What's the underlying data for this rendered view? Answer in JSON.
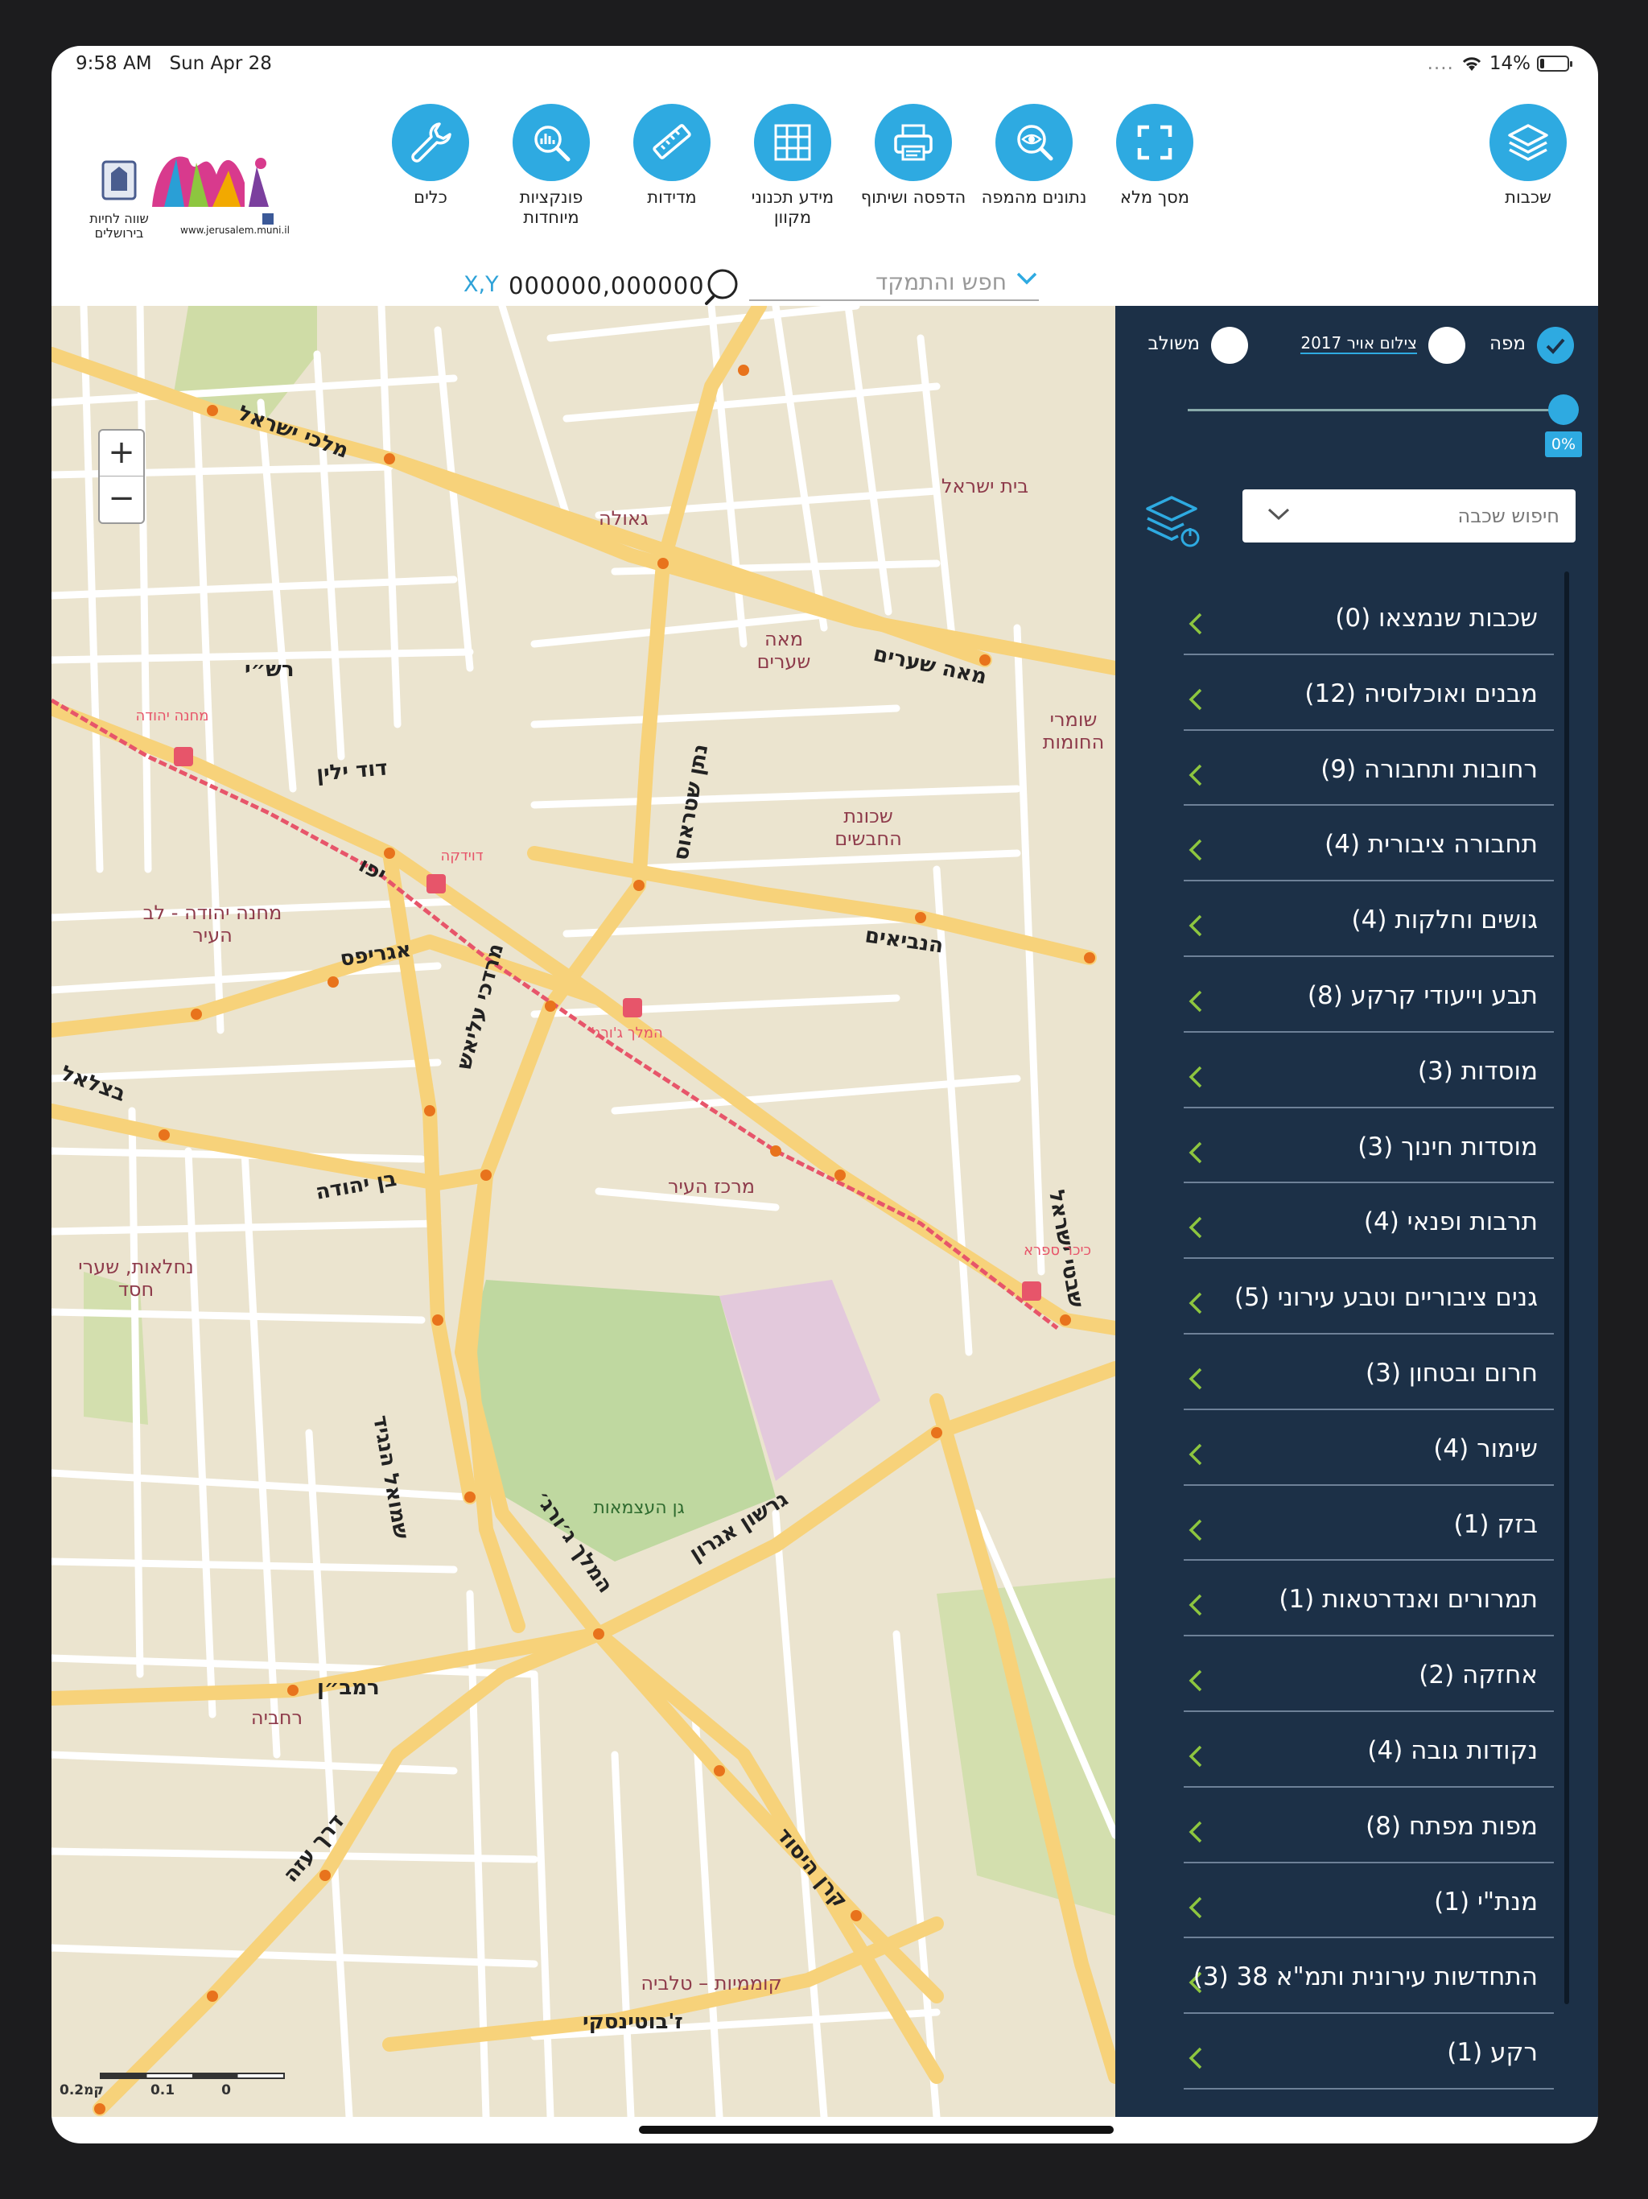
{
  "status_bar": {
    "time": "9:58 AM",
    "date": "Sun Apr 28",
    "signal": "....",
    "battery": "14%",
    "battery_level": 0.14
  },
  "logo": {
    "city_text_line1": "שווה לחיות",
    "city_text_line2": "בירושלים",
    "url": "www.jerusalem.muni.il"
  },
  "toolbar": {
    "tools": [
      {
        "id": "tools",
        "label": "כלים",
        "icon": "wrench-icon"
      },
      {
        "id": "special",
        "label": "פונקציות מיוחדות",
        "icon": "zoom-data-icon"
      },
      {
        "id": "measure",
        "label": "מדידות",
        "icon": "ruler-icon"
      },
      {
        "id": "planning",
        "label": "מידע תכנוני מקוון",
        "icon": "grid-icon"
      },
      {
        "id": "print",
        "label": "הדפסה ושיתוף",
        "icon": "printer-icon"
      },
      {
        "id": "mapdata",
        "label": "נתונים מהמפה",
        "icon": "magnifier-eye-icon"
      },
      {
        "id": "fullscreen",
        "label": "מסך מלא",
        "icon": "fullscreen-icon"
      }
    ],
    "layers": {
      "label": "שכבות",
      "icon": "layers-icon"
    }
  },
  "search": {
    "coord_label": "X,Y",
    "coord_value": "000000,000000",
    "placeholder": "חפש והתמקד"
  },
  "map": {
    "zoom_in": "+",
    "zoom_out": "−",
    "scale_labels": [
      "0.2",
      "0.1",
      "0"
    ],
    "scale_unit": "קמ",
    "places": [
      {
        "name": "גאולה"
      },
      {
        "name": "בית ישראל"
      },
      {
        "name": "מאה שערים"
      },
      {
        "name": "שומרי החומות"
      },
      {
        "name": "שכונת החבשים"
      },
      {
        "name": "מחנה יהודה - לב העיר"
      },
      {
        "name": "מרכז העיר"
      },
      {
        "name": "נחלאות, שערי חסד"
      },
      {
        "name": "רחביה"
      },
      {
        "name": "קוממיות – טלביה"
      },
      {
        "name": "גן העצמאות"
      }
    ],
    "streets": [
      "מלכי ישראל",
      "מאה שערים",
      "הנביאים",
      "יפו",
      "אגריפס",
      "בצלאל",
      "בן יהודה",
      "שמואל הנגיד",
      "המלך ג׳ורג׳",
      "גרשון אגרון",
      "קרן היסוד",
      "רמב״ן",
      "דרך עזה",
      "ז'בוטינסקי",
      "דוד ילין",
      "רש״י",
      "שבטי ישראל",
      "נתן שטראוס",
      "מרדכי עליאש"
    ],
    "stations": [
      "מחנה יהודה",
      "דוידקה",
      "המלך ג'ורג'",
      "כיכר ספרא"
    ],
    "bg_color": "#ebe4cf",
    "road_color": "#f7d27a",
    "tram_color": "#e7556a"
  },
  "panel": {
    "basemaps": [
      {
        "label": "מפה",
        "selected": true
      },
      {
        "label": "צילום אויר 2017",
        "selected": false
      },
      {
        "label": "משולב",
        "selected": false
      }
    ],
    "opacity_label": "0%",
    "opacity_value": 0,
    "layer_search_placeholder": "חיפוש שכבה",
    "layers": [
      "שכבות שנמצאו (0)",
      "מבנים ואוכלוסיה (12)",
      "רחובות ותחבורה (9)",
      "תחבורה ציבורית (4)",
      "גושים וחלקות (4)",
      "תבע וייעודי קרקע (8)",
      "מוסדות (3)",
      "מוסדות חינוך (3)",
      "תרבות ופנאי (4)",
      "גנים ציבוריים וטבע עירוני (5)",
      "חרום ובטחון (3)",
      "שימור (4)",
      "בזק (1)",
      "תמרורים ואנדרטאות (1)",
      "אחזקה (2)",
      "נקודות גובה (4)",
      "מפות מפתח (8)",
      "מנת\"י (1)",
      "התחדשות עירונית ותמ\"א 38 (3)",
      "רקע (1)"
    ]
  },
  "colors": {
    "accent": "#2eaae1",
    "panel_bg": "#1c3047"
  }
}
